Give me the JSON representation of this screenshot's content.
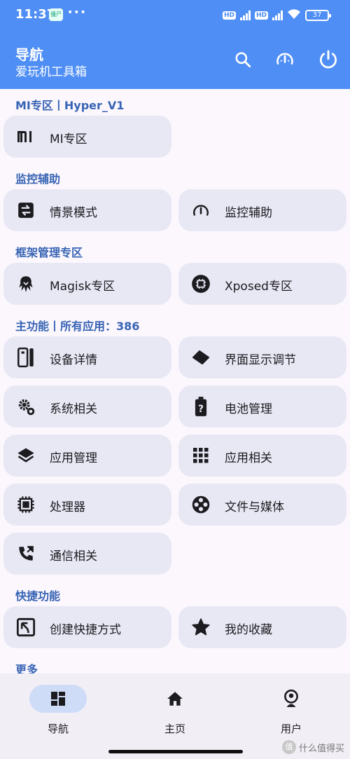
{
  "status_bar": {
    "time": "11:37",
    "notif_label": "僵尸",
    "more": "•••",
    "hd1": "HD",
    "hd2": "HD",
    "battery": "37"
  },
  "app_bar": {
    "title": "导航",
    "subtitle": "爱玩机工具箱"
  },
  "sections": {
    "mi": "MI专区丨Hyper_V1",
    "monitor": "监控辅助",
    "framework": "框架管理专区",
    "main": "主功能丨所有应用：386",
    "quick": "快捷功能",
    "more": "更多"
  },
  "cards": {
    "mi_zone": "MI专区",
    "scene_mode": "情景模式",
    "monitor_assist": "监控辅助",
    "magisk": "Magisk专区",
    "xposed": "Xposed专区",
    "device_info": "设备详情",
    "display_adjust": "界面显示调节",
    "system": "系统相关",
    "battery": "电池管理",
    "app_manage": "应用管理",
    "app_related": "应用相关",
    "processor": "处理器",
    "files_media": "文件与媒体",
    "telecom": "通信相关",
    "shortcut": "创建快捷方式",
    "favorites": "我的收藏"
  },
  "bottom_nav": {
    "nav": "导航",
    "home": "主页",
    "user": "用户"
  },
  "watermark": "什么值得买",
  "colors": {
    "app_bar": "#4f8ef5",
    "section_text": "#3864b4",
    "card_bg": "#e8e8f5",
    "nav_active": "#cfdcf7"
  }
}
